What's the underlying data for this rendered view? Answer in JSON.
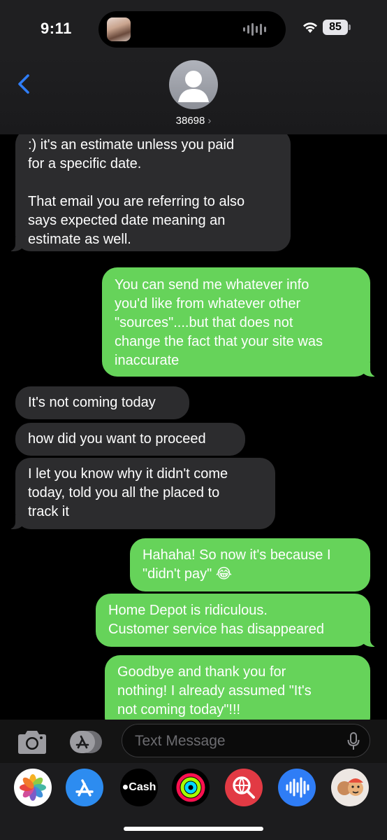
{
  "status": {
    "time": "9:11",
    "battery": "85"
  },
  "header": {
    "contact": "38698"
  },
  "messages": [
    {
      "dir": "in",
      "lines": [
        ":) it's an estimate unless you paid",
        "for a specific date.",
        "",
        "That email you are referring to also",
        "says expected date meaning an",
        "estimate as well."
      ]
    },
    {
      "dir": "out",
      "lines": [
        "You can send me whatever info",
        "you'd like from whatever other",
        "\"sources\"....but that does not",
        "change the fact that your site was",
        "inaccurate"
      ]
    },
    {
      "dir": "in",
      "lines": [
        "It's not coming today"
      ]
    },
    {
      "dir": "in",
      "lines": [
        "how did you want to proceed"
      ]
    },
    {
      "dir": "in",
      "lines": [
        "I let you know why it didn't come",
        "today, told you all the placed to",
        "track it"
      ]
    },
    {
      "dir": "out",
      "lines": [
        "Hahaha! So now it's because I",
        "\"didn't pay\" 😂"
      ]
    },
    {
      "dir": "out",
      "lines": [
        "Home Depot is ridiculous.",
        "Customer service has disappeared"
      ]
    },
    {
      "dir": "out",
      "lines": [
        "Goodbye and thank you for",
        "nothing! I already assumed \"It's",
        "not coming today\"!!!"
      ]
    }
  ],
  "compose": {
    "placeholder": "Text Message"
  },
  "apps": [
    "photos-icon",
    "app-store-icon",
    "cash-icon",
    "fitness-icon",
    "web-search-icon",
    "audio-message-icon",
    "memoji-icon"
  ],
  "app_labels": {
    "cash": "Cash"
  },
  "colors": {
    "incoming": "#2c2c2e",
    "outgoing": "#66d35a",
    "accent": "#2f7df6"
  }
}
